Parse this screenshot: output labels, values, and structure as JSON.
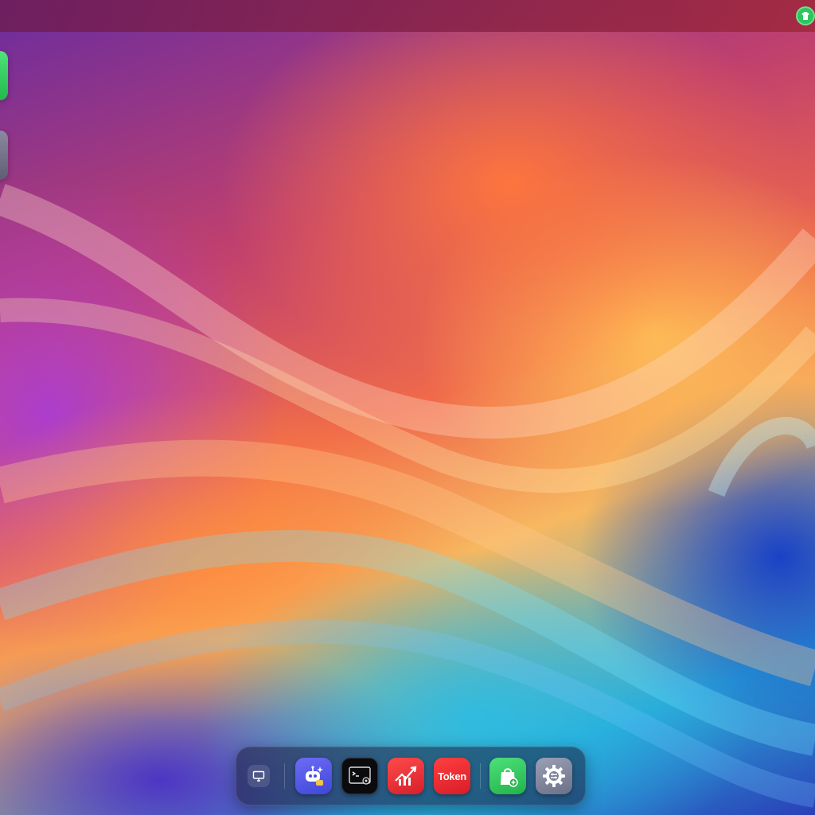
{
  "desktop": {
    "wallpaper": "abstract-rainbow-waves",
    "colors": {
      "topbar": "#8a2a6a",
      "accent_green": "#2cc75a",
      "dock_bg": "#1e1e3c"
    }
  },
  "topbar": {
    "status_icon": "shirt-icon"
  },
  "desktop_tiles": [
    {
      "icon": "green-app-tile"
    },
    {
      "icon": "gray-app-tile"
    }
  ],
  "dock": {
    "items": [
      {
        "icon": "monitor-icon"
      },
      {
        "icon": "ai-robot-icon"
      },
      {
        "icon": "terminal-icon"
      },
      {
        "icon": "stock-chart-icon"
      },
      {
        "icon": "token-icon",
        "label": "Token"
      },
      {
        "icon": "shopping-bag-icon"
      },
      {
        "icon": "gear-icon"
      }
    ]
  }
}
